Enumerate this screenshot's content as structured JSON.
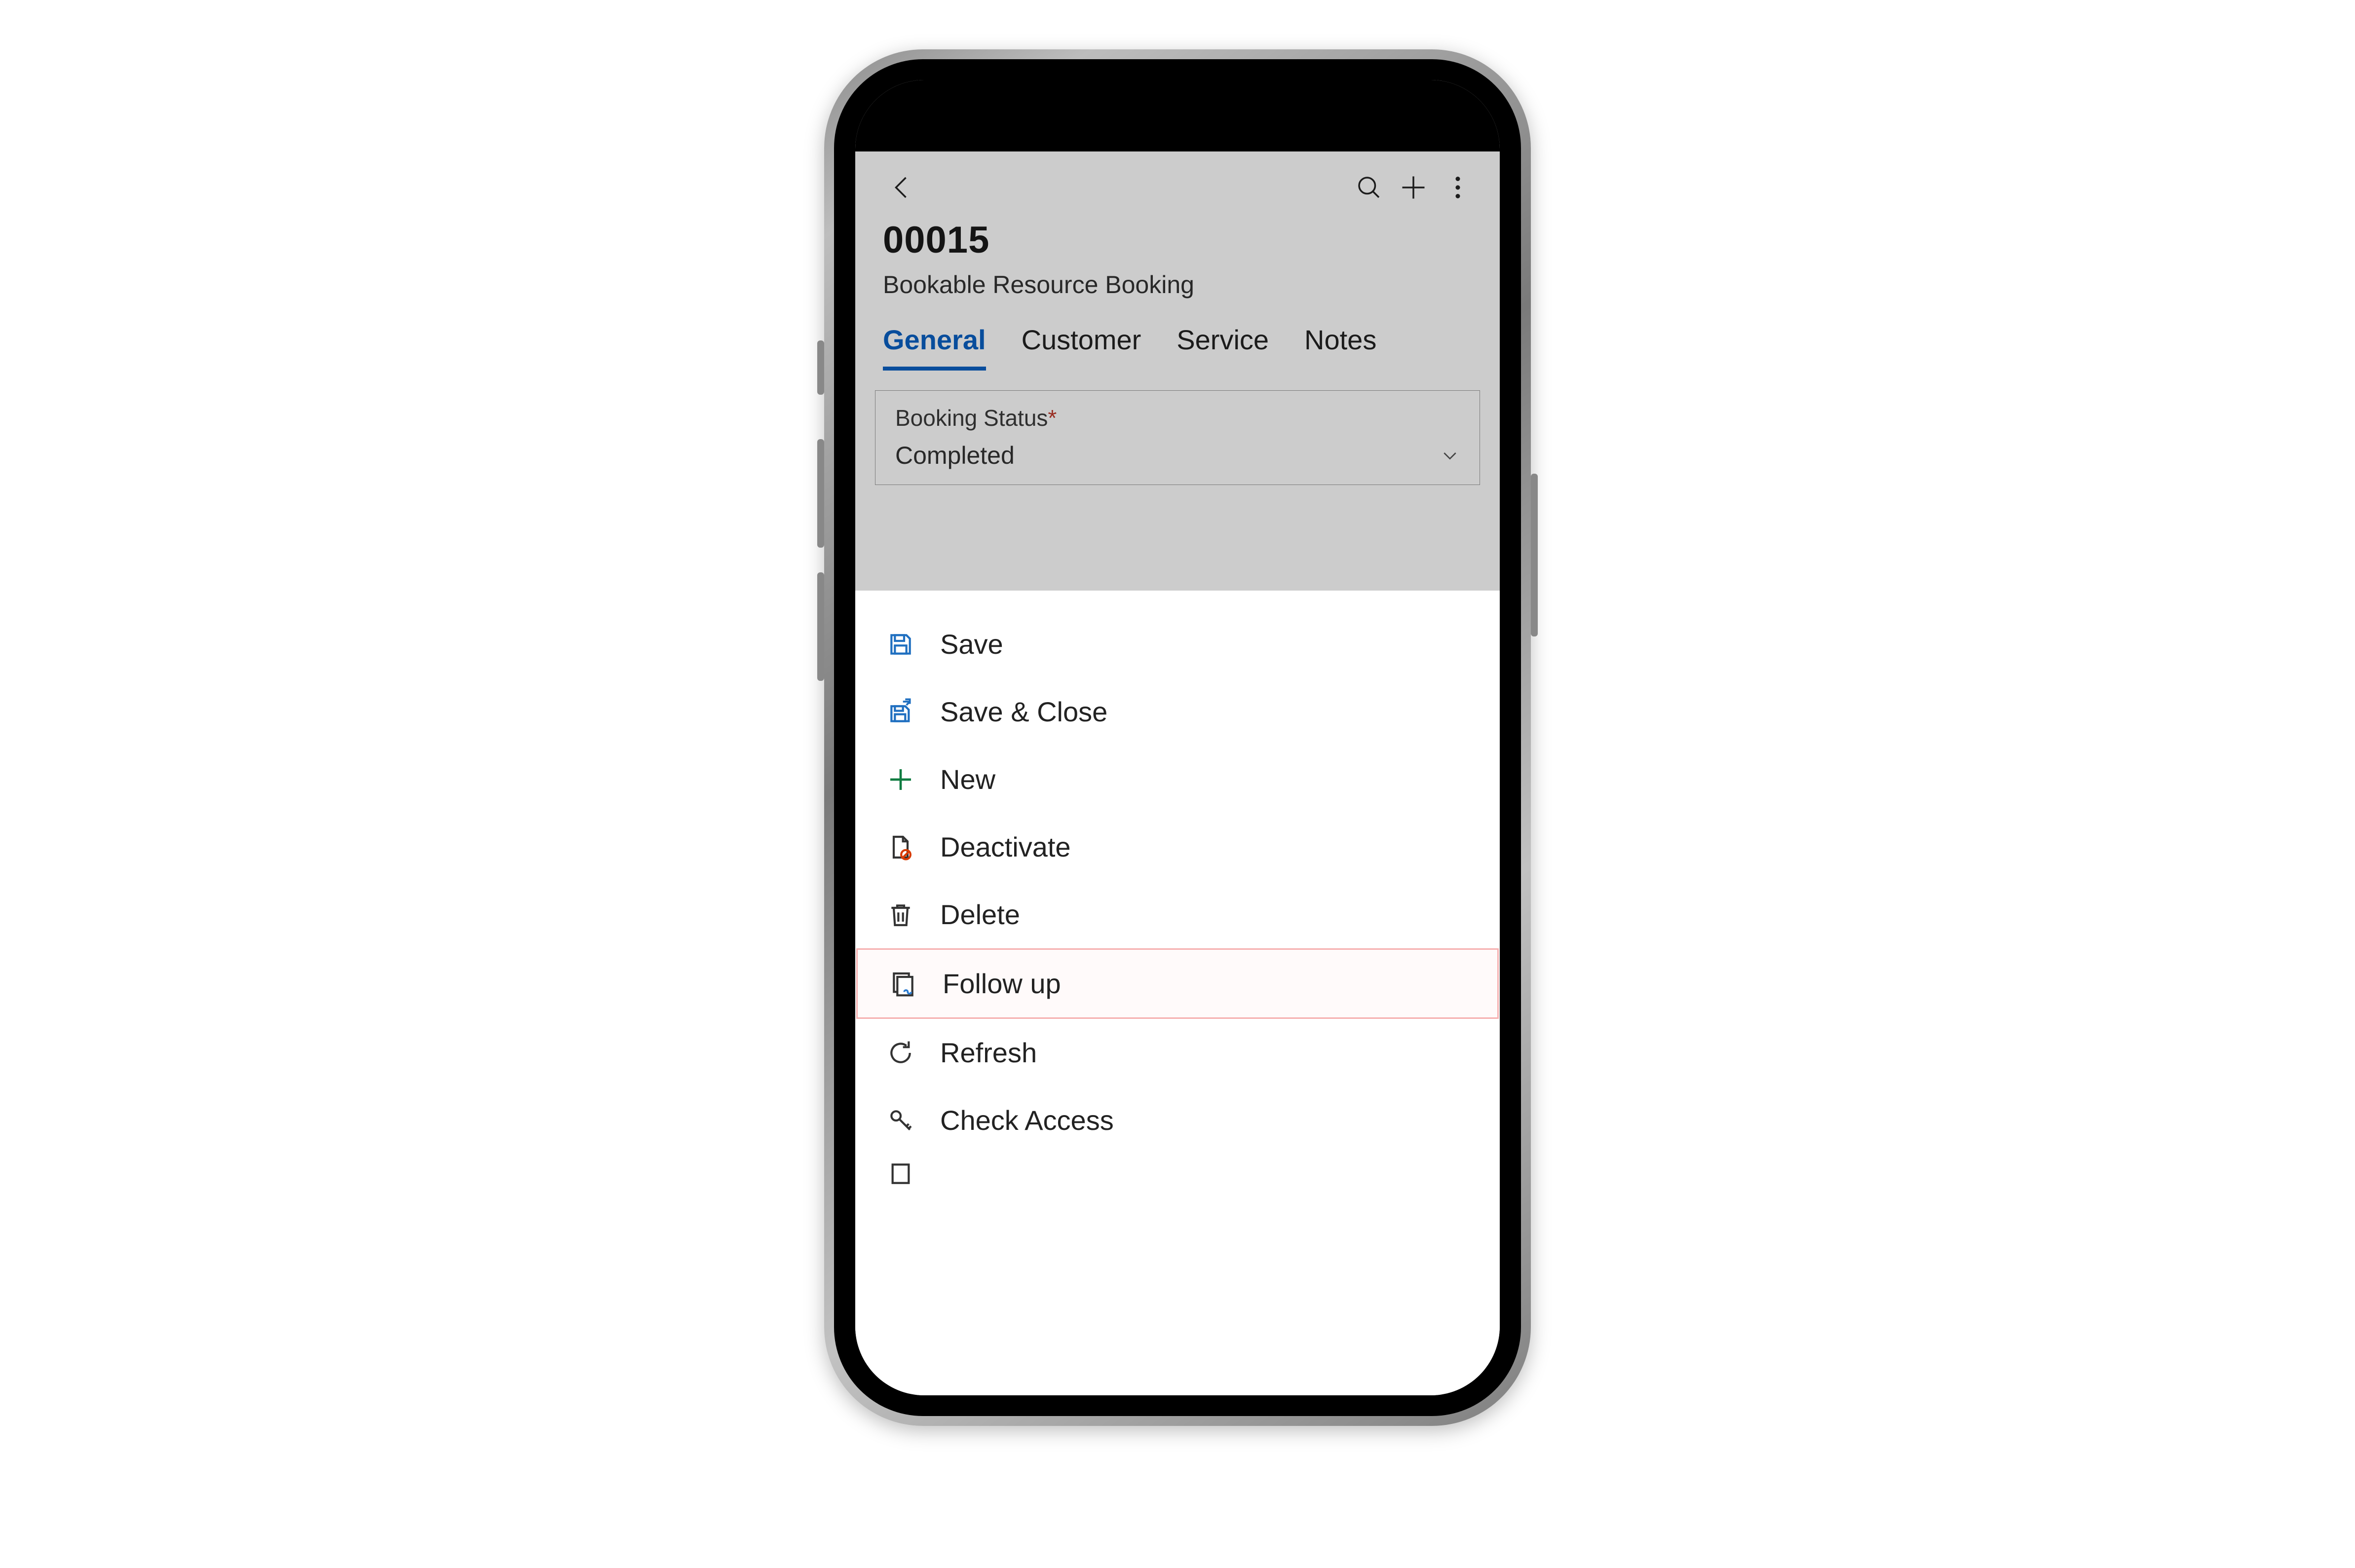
{
  "header": {
    "title": "00015",
    "subtitle": "Bookable Resource Booking"
  },
  "tabs": [
    {
      "label": "General",
      "active": true
    },
    {
      "label": "Customer",
      "active": false
    },
    {
      "label": "Service",
      "active": false
    },
    {
      "label": "Notes",
      "active": false
    }
  ],
  "field": {
    "label": "Booking Status",
    "required_marker": "*",
    "value": "Completed"
  },
  "menu": {
    "save": "Save",
    "save_close": "Save & Close",
    "new": "New",
    "deactivate": "Deactivate",
    "delete": "Delete",
    "follow_up": "Follow up",
    "refresh": "Refresh",
    "check_access": "Check Access"
  }
}
